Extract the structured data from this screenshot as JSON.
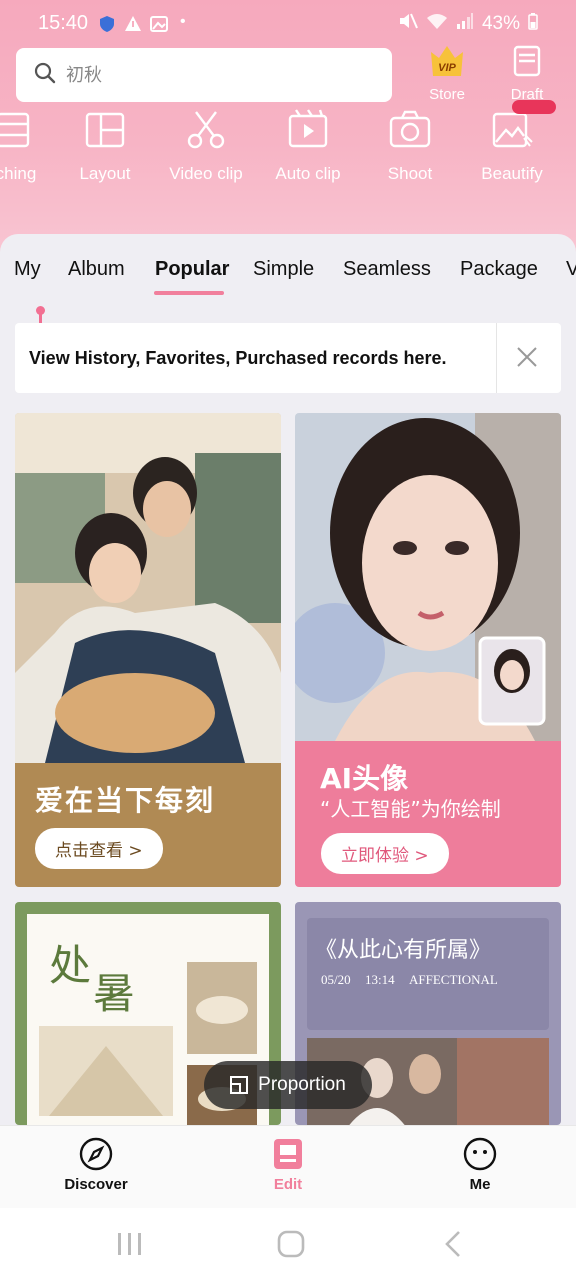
{
  "status": {
    "time": "15:40",
    "battery": "43%"
  },
  "search": {
    "placeholder": "初秋"
  },
  "top_buttons": {
    "store": "Store",
    "draft": "Draft",
    "vip_badge": "VIP"
  },
  "tools": [
    "ching",
    "Layout",
    "Video clip",
    "Auto clip",
    "Shoot",
    "Beautify"
  ],
  "tabs": [
    "My",
    "Album",
    "Popular",
    "Simple",
    "Seamless",
    "Package",
    "V"
  ],
  "notice": {
    "text": "View History, Favorites, Purchased records here."
  },
  "cards": {
    "c1": {
      "title": "爱在当下每刻",
      "button": "点击查看 >"
    },
    "c2": {
      "title": "AI头像",
      "subtitle": "“人工智能”为你绘制",
      "button": "立即体验 >"
    },
    "c3": {
      "title1": "处",
      "title2": "暑"
    },
    "c4": {
      "title": "《从此心有所属》",
      "date": "05/20",
      "time": "13:14",
      "word": "AFFECTIONAL"
    }
  },
  "proportion": {
    "label": "Proportion"
  },
  "nav": {
    "discover": "Discover",
    "edit": "Edit",
    "me": "Me"
  },
  "colors": {
    "accent": "#f17f9c",
    "card1": "#b08a54",
    "card2": "#ee7d9b",
    "card3": "#7c9a5e",
    "card4": "#9a96b5"
  }
}
